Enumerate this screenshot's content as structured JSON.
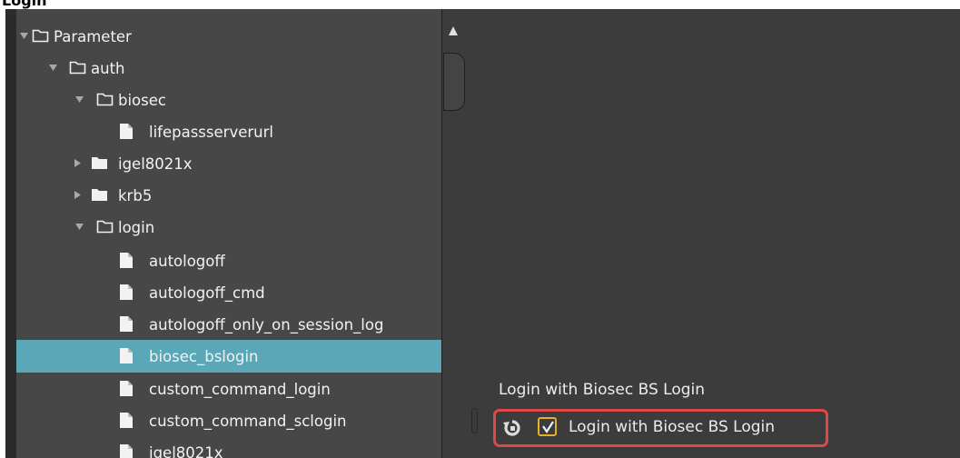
{
  "window": {
    "title": "Login"
  },
  "tree": [
    {
      "label": "Parameter",
      "kind": "folder",
      "state": "expanded"
    },
    {
      "label": "auth",
      "kind": "folder",
      "state": "expanded"
    },
    {
      "label": "biosec",
      "kind": "folder",
      "state": "expanded"
    },
    {
      "label": "lifepassserverurl",
      "kind": "file"
    },
    {
      "label": "igel8021x",
      "kind": "folder",
      "state": "collapsed"
    },
    {
      "label": "krb5",
      "kind": "folder",
      "state": "collapsed"
    },
    {
      "label": "login",
      "kind": "folder",
      "state": "expanded"
    },
    {
      "label": "autologoff",
      "kind": "file"
    },
    {
      "label": "autologoff_cmd",
      "kind": "file"
    },
    {
      "label": "autologoff_only_on_session_log",
      "kind": "file"
    },
    {
      "label": "biosec_bslogin",
      "kind": "file",
      "selected": true
    },
    {
      "label": "custom_command_login",
      "kind": "file"
    },
    {
      "label": "custom_command_sclogin",
      "kind": "file"
    },
    {
      "label": "igel8021x",
      "kind": "file"
    }
  ],
  "setting": {
    "title": "Login with Biosec BS Login",
    "checkbox_label": "Login with Biosec BS Login",
    "checked": true,
    "reset_icon": "reset-icon"
  },
  "colors": {
    "selection": "#5aa7b8",
    "highlight_border": "#e04848",
    "checkbox_border": "#e3b226"
  }
}
